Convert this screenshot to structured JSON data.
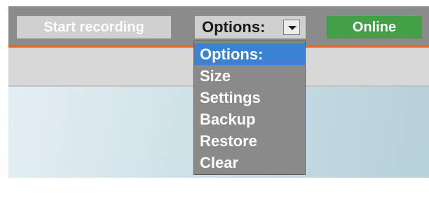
{
  "toolbar": {
    "record_label": "Start recording",
    "options_selected": "Options:",
    "status_label": "Online"
  },
  "options_menu": {
    "items": [
      "Options:",
      "Size",
      "Settings",
      "Backup",
      "Restore",
      "Clear"
    ],
    "highlighted_index": 0
  },
  "colors": {
    "toolbar_bg": "#8b8b8b",
    "accent_line": "#e86a1e",
    "online_green": "#43a047",
    "highlight_blue": "#3a82d2"
  },
  "icons": {
    "select_arrow": "chevron-down-icon"
  }
}
